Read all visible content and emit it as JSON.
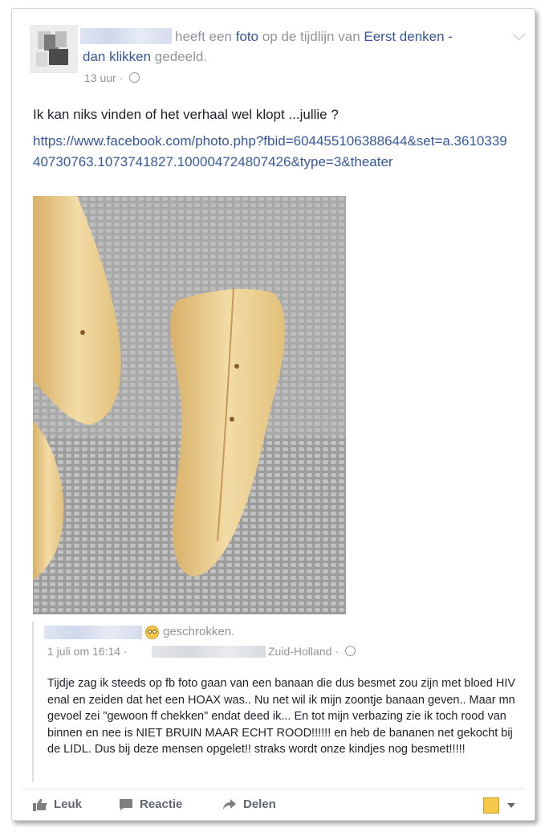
{
  "post": {
    "header_part1": "heeft een",
    "header_link_photo": "foto",
    "header_part2": "op de tijdlijn van",
    "header_link_page_1": "Eerst denken -",
    "header_link_page_2": "dan klikken",
    "header_part3": "gedeeld.",
    "time": "13 uur",
    "separator": "·",
    "text": "Ik kan niks vinden of het verhaal wel klopt ...jullie ?",
    "link": "https://www.facebook.com/photo.php?fbid=604455106388644&set=a.361033940730763.1073741827.100004724807426&type=3&theater"
  },
  "shared": {
    "feeling": "geschrokken.",
    "date": "1 juli om 16:14",
    "sep": "·",
    "place": "Zuid-Holland",
    "body": "Tijdje zag ik steeds op fb foto gaan van een banaan die dus besmet zou zijn met bloed HIV enal en zeiden dat het een HOAX was.. Nu net wil ik mijn zoontje banaan geven.. Maar mn gevoel zei \"gewoon ff chekken\" endat deed ik... En tot mijn verbazing zie ik toch rood van binnen en nee is NIET BRUIN MAAR ECHT ROOD!!!!!! en heb de bananen net gekocht bij de LIDL. Dus bij deze mensen opgelet!! straks wordt onze kindjes nog besmet!!!!!"
  },
  "actions": {
    "like": "Leuk",
    "comment": "Reactie",
    "share": "Delen"
  },
  "icons": [
    "like-icon",
    "comment-icon",
    "share-icon",
    "globe-icon",
    "chevron-down-icon",
    "emoji-shocked-icon"
  ]
}
